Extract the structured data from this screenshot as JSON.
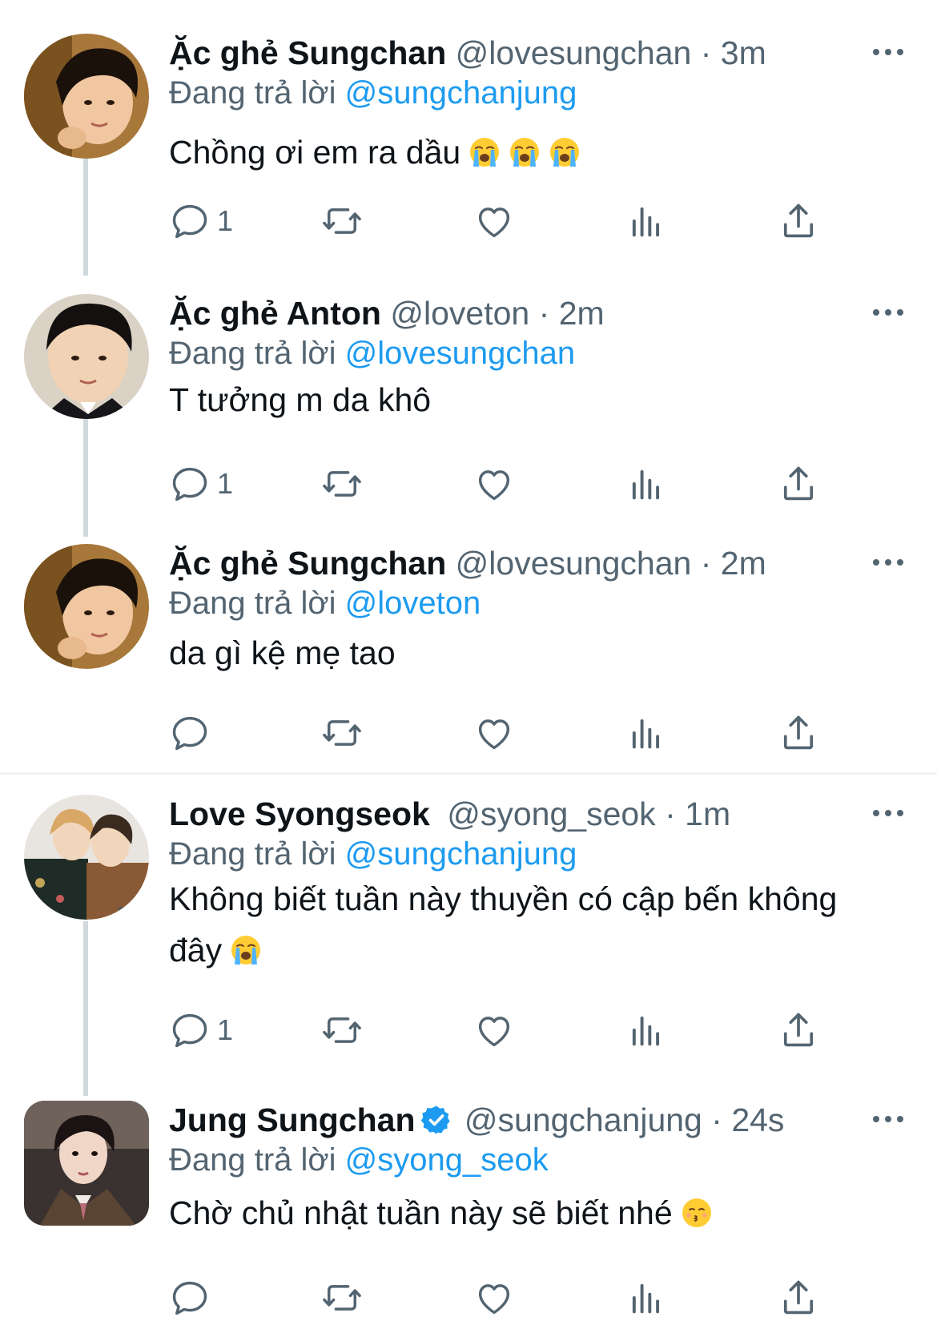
{
  "reply_prefix": "Đang trả lời",
  "colors": {
    "link": "#1d9bf0",
    "secondary": "#536471",
    "primary": "#0f1419",
    "thread_line": "#cfd9de"
  },
  "icons": {
    "reply": "reply-icon",
    "retweet": "retweet-icon",
    "like": "heart-icon",
    "analytics": "analytics-icon",
    "share": "share-icon",
    "more": "more-icon"
  },
  "tweets": [
    {
      "display_name": "Ặc ghẻ Sungchan",
      "handle": "@lovesungchan",
      "time": "3m",
      "reply_to": "@sungchanjung",
      "text": "Chồng ơi em ra dầu",
      "emoji": [
        "loudly-crying-face",
        "loudly-crying-face",
        "loudly-crying-face"
      ],
      "reply_count": "1"
    },
    {
      "display_name": "Ặc ghẻ Anton",
      "handle": "@loveton",
      "time": "2m",
      "reply_to": "@lovesungchan",
      "text": "T tưởng m da khô",
      "emoji": [],
      "reply_count": "1"
    },
    {
      "display_name": "Ặc ghẻ Sungchan",
      "handle": "@lovesungchan",
      "time": "2m",
      "reply_to": "@loveton",
      "text": "da gì kệ mẹ tao",
      "emoji": [],
      "reply_count": ""
    },
    {
      "display_name": "Love Syongseok",
      "handle": "@syong_seok",
      "time": "1m",
      "reply_to": "@sungchanjung",
      "text_line1": "Không biết tuần này thuyền có cập bến không",
      "text_line2": "đây",
      "emoji": [
        "loudly-crying-face"
      ],
      "reply_count": "1"
    },
    {
      "display_name": "Jung Sungchan",
      "verified": true,
      "handle": "@sungchanjung",
      "time": "24s",
      "reply_to": "@syong_seok",
      "text": "Chờ chủ nhật tuần này sẽ biết nhé",
      "emoji": [
        "kissing-face"
      ],
      "reply_count": ""
    }
  ]
}
